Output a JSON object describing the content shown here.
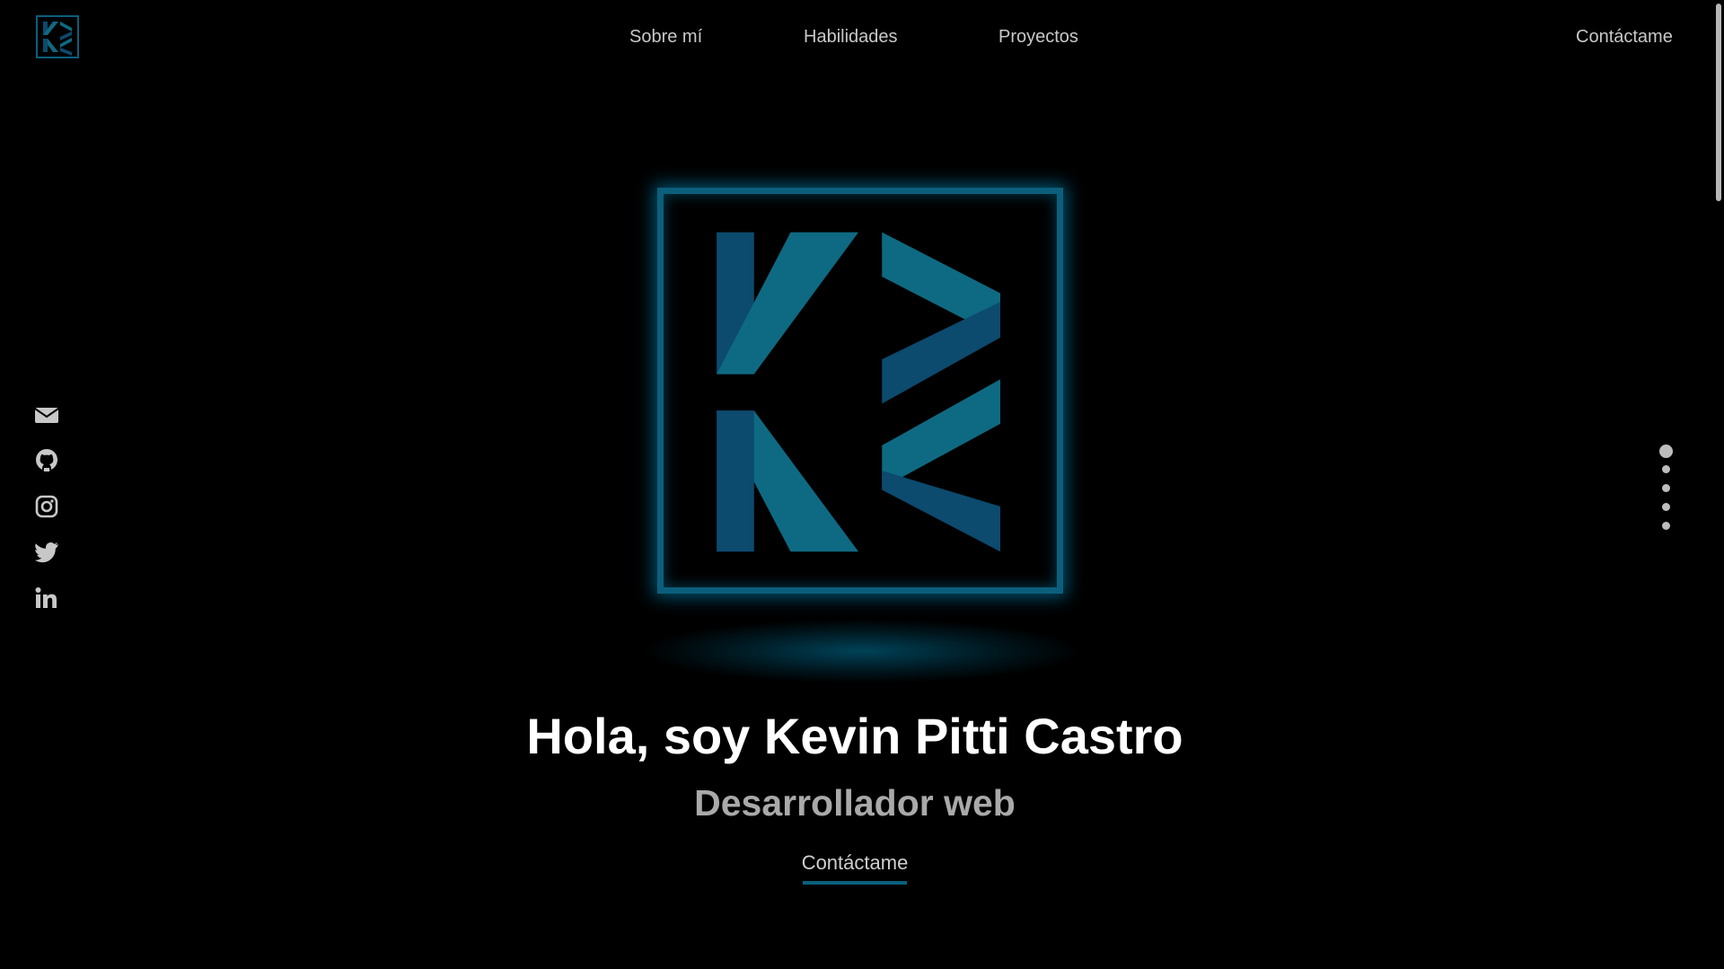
{
  "nav": {
    "about": "Sobre mí",
    "skills": "Habilidades",
    "projects": "Proyectos",
    "contact": "Contáctame"
  },
  "hero": {
    "title": "Hola, soy Kevin Pitti Castro",
    "subtitle": "Desarrollador web",
    "cta": "Contáctame"
  },
  "social": [
    "envelope-icon",
    "github-icon",
    "instagram-icon",
    "twitter-icon",
    "linkedin-icon"
  ],
  "section_dots": {
    "count": 5,
    "active_index": 0
  },
  "colors": {
    "background": "#000000",
    "accent": "#0b5f7c",
    "logo_dark": "#0c4a6e",
    "logo_light": "#0e6a82",
    "text_primary": "#ffffff",
    "text_secondary": "#a9a9a9",
    "nav_text": "#c8c8c8"
  }
}
